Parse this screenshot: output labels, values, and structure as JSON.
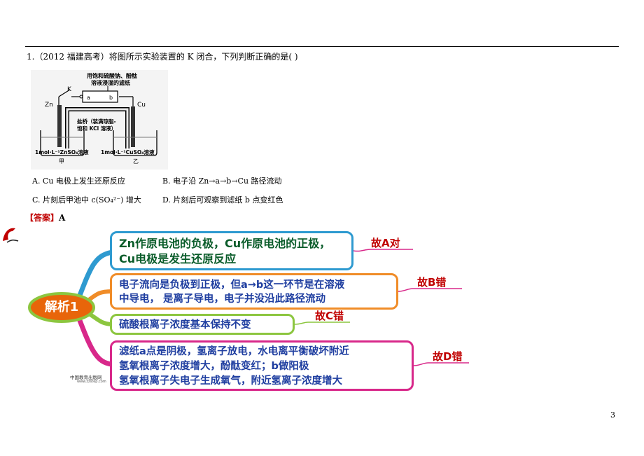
{
  "question": {
    "text": "1.（2012 福建高考）将图所示实验装置的 K 闭合，下列判断正确的是(        )"
  },
  "figure": {
    "paper_label_line1": "用饱和硫酸钠、酚酞",
    "paper_label_line2": "溶液浸湿的滤纸",
    "k_label": "K",
    "a_label": "a",
    "b_label": "b",
    "zn_label": "Zn",
    "cu_label": "Cu",
    "salt_bridge_line1": "盐桥（装满琼脂-",
    "salt_bridge_line2": "饱和 KCl 溶液）",
    "left_solution": "1mol·L⁻¹ZnSO₄溶液",
    "right_solution": "1mol·L⁻¹CuSO₄溶液",
    "left_name": "甲",
    "right_name": "乙"
  },
  "options": {
    "a": "A. Cu 电极上发生还原反应",
    "b": "B. 电子沿 Zn→a→b→Cu 路径流动",
    "c": "C. 片刻后甲池中 c(SO₄²⁻) 增大",
    "d": "D. 片刻后可观察到滤纸 b 点变红色"
  },
  "answer": {
    "label": "【答案】",
    "value": "A"
  },
  "mindmap": {
    "center": "解析1",
    "box1": {
      "line1": "Zn作原电池的负极，Cu作原电池的正极，",
      "line2": "Cu电极是发生还原反应"
    },
    "box2": {
      "line1": "电子流向是负极到正极，但a→b这一环节是在溶液",
      "line2": "中导电， 是离子导电，电子并没沿此路径流动"
    },
    "box3": {
      "line1": "硫酸根离子浓度基本保持不变"
    },
    "box4": {
      "line1": "滤纸a点是阴极，氢离子放电，水电离平衡破坏附近",
      "line2": "氢氧根离子浓度增大，酚酞变红；b做阳极",
      "line3": "氢氧根离子失电子生成氧气，附近氢离子浓度增大"
    },
    "verdict_a": "故A对",
    "verdict_b": "故B错",
    "verdict_c": "故C错",
    "verdict_d": "故D错",
    "logo_text": "中国教育出版网",
    "logo_url": "www.zzstep.com",
    "colors": {
      "blue": "#2e9ad0",
      "orange": "#f08c28",
      "green": "#8cc63f",
      "magenta": "#d8288a",
      "verdict": "#c00000"
    }
  },
  "page_number": "3"
}
